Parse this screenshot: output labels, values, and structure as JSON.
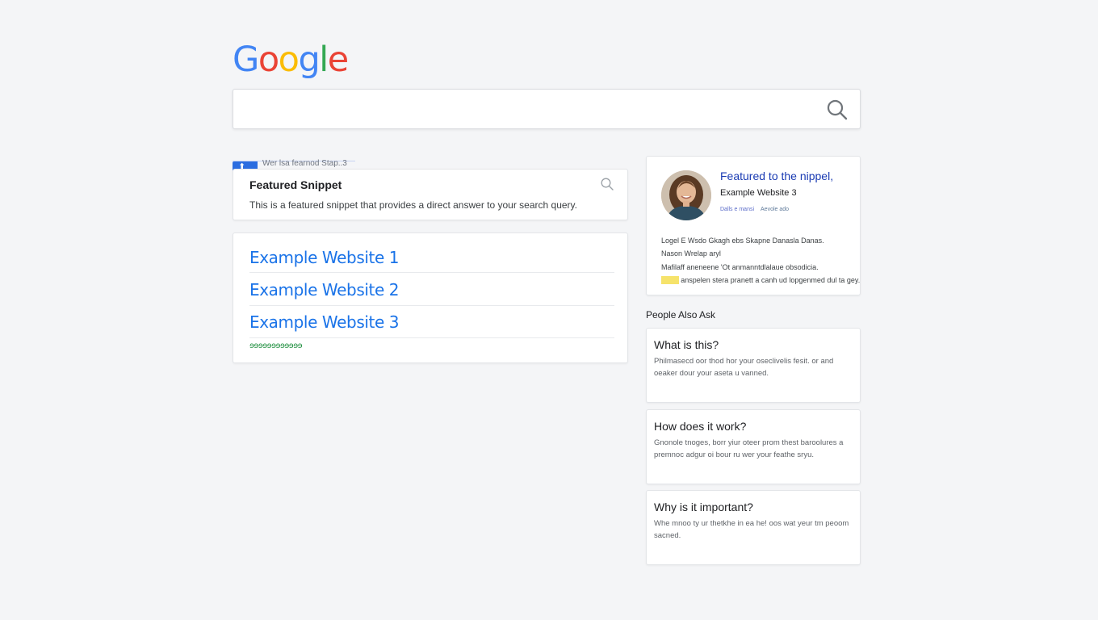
{
  "logo": {
    "letters": [
      "G",
      "o",
      "o",
      "g",
      "l",
      "e"
    ],
    "colors": [
      "#4285F4",
      "#EA4335",
      "#FBBC05",
      "#4285F4",
      "#34A853",
      "#EA4335"
    ]
  },
  "search": {
    "value": "",
    "icon": "search-icon"
  },
  "featured_snippet": {
    "tab_label": "Wer lsa fearnod Stap..3",
    "marker_glyph": "⬆",
    "title": "Featured Snippet",
    "text": "This is a featured snippet that provides a direct answer to your search query.",
    "icon": "search-icon"
  },
  "results": [
    {
      "title": "Example Website 1"
    },
    {
      "title": "Example Website 2"
    },
    {
      "title": "Example Website 3"
    }
  ],
  "result_url": "ɘɘɘɘɘɘɘɘɘɘɘɘ",
  "knowledge_panel": {
    "title": "Featured to the nippel,",
    "subtitle": "Example Website 3",
    "tags": [
      "Dalls e mansi",
      "Aevole ado"
    ],
    "lines": [
      "Logel E Wsdo Gkagh ebs Skapne Danasla Danas.",
      "Nason Wrelap aryl",
      "Mafilaff aneneene 'Ot anmanntdlalaue obsodicia.",
      "anspelen stera pranett a canh ud lopgenmed dul ta gey."
    ],
    "highlight": "■■■■"
  },
  "people_also_ask": {
    "heading": "People Also Ask",
    "items": [
      {
        "question": "What is this?",
        "answer": "Philmasecd oor thod hor your oseclivelis fesit. or and oeaker dour your aseta u vanned."
      },
      {
        "question": "How does it work?",
        "answer": "Gnonole tnoges, borr yiur oteer prom thest baroolures a premnoc adgur oi bour ru wer your feathe sryu."
      },
      {
        "question": "Why is it important?",
        "answer": "Whe mnoo ty ur thetkhe in ea he! oos wat yeur tm peoom sacned."
      }
    ]
  }
}
